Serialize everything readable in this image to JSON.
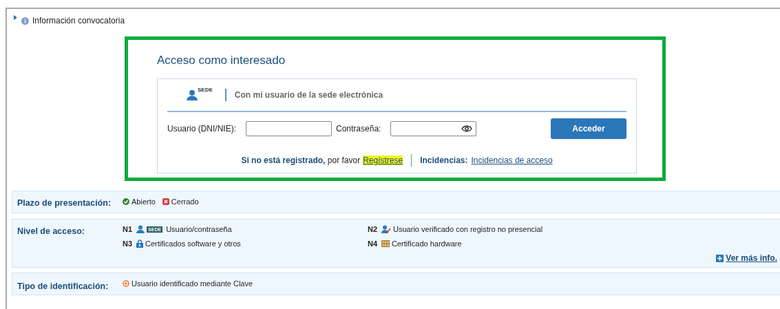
{
  "info_header": {
    "label": "Información convocatoria",
    "expanded": false
  },
  "login": {
    "title": "Acceso como interesado",
    "method_badge": "SEDE",
    "method_label": "Con mi usuario de la sede electrónica",
    "user_label": "Usuario (DNI/NIE):",
    "password_label": "Contraseña:",
    "submit": "Acceder",
    "register_prompt_bold": "Si no está registrado,",
    "register_prompt": "por favor",
    "register_link": "Regístrese",
    "incidents_label": "Incidencias:",
    "incidents_link": "Incidencias de acceso"
  },
  "deadline": {
    "label": "Plazo de presentación:",
    "statuses": [
      {
        "kind": "open",
        "label": "Abierto"
      },
      {
        "kind": "closed",
        "label": "Cerrado"
      }
    ]
  },
  "access_level": {
    "label": "Nivel de acceso:",
    "levels": [
      {
        "code": "N1",
        "kind": "user-sede",
        "badge": "SEDE",
        "label": "Usuario/contraseña"
      },
      {
        "code": "N2",
        "kind": "user-verified",
        "label": "Usuario verificado con registro no presencial"
      },
      {
        "code": "N3",
        "kind": "lock",
        "label": "Certificados software y otros"
      },
      {
        "code": "N4",
        "kind": "chip",
        "label": "Certificado hardware"
      }
    ],
    "more_link": "Ver más info."
  },
  "identification": {
    "label": "Tipo de identificación:",
    "value": "Usuario identificado mediante Clave"
  }
}
